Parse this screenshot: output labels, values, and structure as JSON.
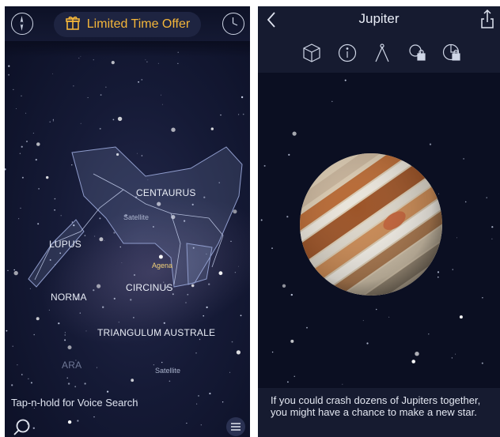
{
  "left_screen": {
    "offer_label": "Limited Time Offer",
    "constellations": {
      "centaurus": "CENTAURUS",
      "lupus": "LUPUS",
      "norma": "NORMA",
      "circinus": "CIRCINUS",
      "triangulum_australe": "TRIANGULUM AUSTRALE",
      "ara": "ARA"
    },
    "small_labels": {
      "satellite_1": "Satellite",
      "agena": "Agena",
      "satellite_2": "Satellite"
    },
    "voice_hint": "Tap-n-hold for Voice Search",
    "icons": [
      "compass-icon",
      "gift-icon",
      "time-dial-icon",
      "search-icon",
      "menu-icon"
    ]
  },
  "right_screen": {
    "title": "Jupiter",
    "toolbar_icons": [
      "3d-cube-icon",
      "info-icon",
      "compass-divider-icon",
      "locked-cloud-icon",
      "locked-pie-icon"
    ],
    "fact": "If you could crash dozens of Jupiters together, you might have a chance to make a new star.",
    "colors": {
      "accent_gold": "#f4b63a",
      "panel_bg": "#161b30"
    }
  }
}
